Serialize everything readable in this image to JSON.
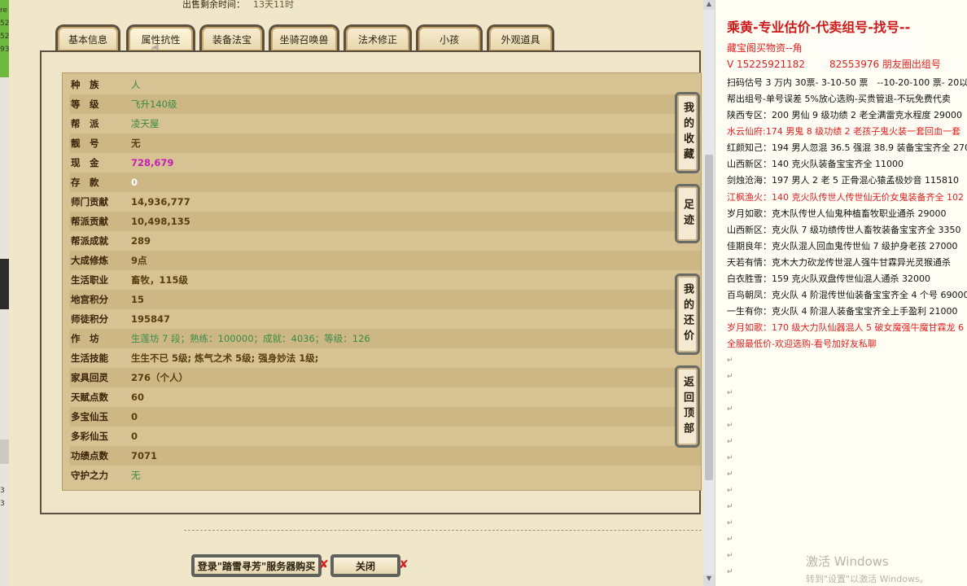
{
  "left_fragments": [
    "re",
    "52",
    "52",
    "93"
  ],
  "left_lower_fragments": [
    "3",
    "3"
  ],
  "header": {
    "sale_time_label": "出售剩余时间：",
    "sale_time_value": "13天11时"
  },
  "tabs": [
    {
      "label": "基本信息"
    },
    {
      "label": "属性抗性"
    },
    {
      "label": "装备法宝"
    },
    {
      "label": "坐骑召唤兽"
    },
    {
      "label": "法术修正"
    },
    {
      "label": "小孩"
    },
    {
      "label": "外观道具"
    }
  ],
  "info_rows": [
    {
      "key": "种　族",
      "value": "人"
    },
    {
      "key": "等　级",
      "value": "飞升140级"
    },
    {
      "key": "帮　派",
      "value": "凌天屋"
    },
    {
      "key": "靓　号",
      "value": "无"
    },
    {
      "key": "现　金",
      "value": "728,679"
    },
    {
      "key": "存　款",
      "value": "0"
    },
    {
      "key": "师门贡献",
      "value": "14,936,777"
    },
    {
      "key": "帮派贡献",
      "value": "10,498,135"
    },
    {
      "key": "帮派成就",
      "value": "289"
    },
    {
      "key": "大成修炼",
      "value": "9点"
    },
    {
      "key": "生活职业",
      "value": "畜牧，115级"
    },
    {
      "key": "地宫积分",
      "value": "15"
    },
    {
      "key": "师徒积分",
      "value": "195847"
    },
    {
      "key": "作　坊",
      "value": "生莲坊 7 段；熟练：100000；成就：4036；等级：126"
    },
    {
      "key": "生活技能",
      "value": "生生不已 5级; 炼气之术 5级; 强身妙法 1级;"
    },
    {
      "key": "家具回灵",
      "value": "276（个人）"
    },
    {
      "key": "天赋点数",
      "value": "60"
    },
    {
      "key": "多宝仙玉",
      "value": "0"
    },
    {
      "key": "多彩仙玉",
      "value": "0"
    },
    {
      "key": "功绩点数",
      "value": "7071"
    },
    {
      "key": "守护之力",
      "value": "无"
    }
  ],
  "side_buttons": [
    {
      "label": "我的收藏"
    },
    {
      "label": "足迹"
    },
    {
      "label": "我的还价"
    },
    {
      "label": "返回顶部"
    }
  ],
  "bottom_buttons": {
    "login_label": "登录\"踏雪寻芳\"服务器购买",
    "close_label": "关闭"
  },
  "doc": {
    "title": "乘黄-专业估价-代卖组号-找号--",
    "line1": "藏宝阁买物资--角",
    "line2": "V 15225921182",
    "line2b": "82553976 朋友圈出组号",
    "lines": [
      "扫码估号 3 万内 30票- 3-10-50 票　--10-20-100 票- 20以上 1",
      "帮出组号-单号误差 5%放心选购-买贵管退-不玩免费代卖",
      "陕西专区：200 男仙 9 级功绩 2 老全满雷克水程度 29000",
      "水云仙府:174 男鬼 8 级功绩 2 老孩子鬼火装一套回血一套",
      "红颜知己：194 男人忽混 36.5 强混 38.9 装备宝宝齐全 2700",
      "山西新区：140 克火队装备宝宝齐全 11000",
      "剑烛沧海：197 男人 2 老 5 正骨混心猿孟极妙音 115810",
      "江枫渔火：140 克火队传世人传世仙无价女鬼装备齐全 102",
      "岁月如歌：克木队传世人仙鬼种植畜牧职业通杀 29000",
      "山西新区：克火队 7 级功绩传世人畜牧装备宝宝齐全 3350",
      "佳期良年：克火队混人回血鬼传世仙 7 级护身老孩 27000",
      "天若有情：克木大力砍龙传世混人强牛甘霖异光灵猴通杀",
      "白衣胜雪：159 克火队双盘传世仙混人通杀 32000",
      "百鸟朝凤：克火队 4 阶混传世仙装备宝宝齐全 4 个号 69000",
      "一生有你：克火队 4 阶混人装备宝宝齐全上手盈利 21000",
      "岁月如歌：170 级大力队仙器混人 5 破女魔强牛魔甘霖龙 6",
      "全服最低价-欢迎选购-看号加好友私聊"
    ]
  },
  "watermark": {
    "line1": "激活 Windows",
    "line2": "转到\"设置\"以激活 Windows。"
  }
}
